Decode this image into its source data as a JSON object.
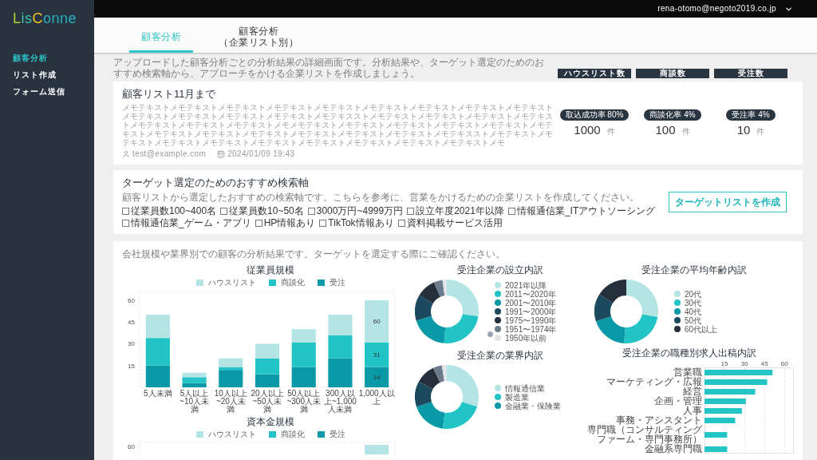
{
  "sidebar": {
    "logo": "LisConne",
    "items": [
      {
        "label": "顧客分析",
        "selected": true
      },
      {
        "label": "リスト作成",
        "selected": false
      },
      {
        "label": "フォーム送信",
        "selected": false
      }
    ]
  },
  "top_bar": {
    "user_email": "rena-otomo@negoto2019.co.jp"
  },
  "tabs": [
    {
      "label": "顧客分析",
      "selected": true
    },
    {
      "label": "顧客分析（企業リスト別）",
      "selected": false
    }
  ],
  "intro": "アップロードした顧客分析ごとの分析結果の詳細画面です。分析結果や、ターゲット選定のためのおすすめ検索軸から、アプローチをかける企業リストを作成しましょう。",
  "stat_headers": [
    "ハウスリスト数",
    "商談数",
    "受注数"
  ],
  "list_card": {
    "title": "顧客リスト11月まで",
    "memo": "メモテキストメモテキストメモテキストメモテキストメモテキストメモテキストメモテキストメモテキストメモテキストメモテキストメモテキストメモテキストメモテキストメモテキスストメモテキストメモテキストメモテキストメモテキストメモテキストメモテキストメモテキストメモメモテキストメモテキストメモテキストメモテキストメモテキストメモテキストメモテキストメモテキストメモテキストメモテキストメモテキストメモテキストメモテキスストメモテキストメモテキストメモテキストメモテキストメモテキストメモテキストメモテキストメモテキストメモテキストメモ",
    "owner": "test@example.com",
    "updated_at": "2024/01/09 19:43",
    "stats": [
      {
        "rate": "取込成功率 80%",
        "count": "1000",
        "unit": "件"
      },
      {
        "rate": "商談化率 4%",
        "count": "100",
        "unit": "件"
      },
      {
        "rate": "受注率 4%",
        "count": "10",
        "unit": "件"
      }
    ]
  },
  "target_card": {
    "title": "ターゲット選定のためのおすすめ検索軸",
    "description": "顧客リストから選定したおすすめの検索軸です。こちらを参考に、営業をかけるための企業リストを作成してください。",
    "criteria": [
      {
        "label": "従業員数100~400名",
        "checked": false
      },
      {
        "label": "従業員数10~50名",
        "checked": false
      },
      {
        "label": "3000万円~4999万円",
        "checked": false
      },
      {
        "label": "設立年度2021年以降",
        "checked": false
      },
      {
        "label": "情報通信業_ITアウトソーシング",
        "checked": false
      },
      {
        "label": "情報通信業_ゲーム・アプリ",
        "checked": false
      },
      {
        "label": "HP情報あり",
        "checked": false
      },
      {
        "label": "TikTok情報あり",
        "checked": false
      },
      {
        "label": "資料掲載サービス活用",
        "checked": false
      }
    ],
    "button": "ターゲットリストを作成"
  },
  "analysis": {
    "description": "会社規模や業界別での顧客の分析結果です。ターゲットを選定する際にご確認ください。",
    "employee_chart": {
      "chart_data": {
        "type": "bar",
        "title": "従業員規模",
        "categories": [
          "5人未満",
          "5人以上~10人未満",
          "10人以上~20人未満",
          "20人以上~50人未満",
          "50人以上~300人未満",
          "300人以上~1,000人未満",
          "1,000人以上"
        ],
        "series": [
          {
            "name": "受注",
            "color": "#0a99a6",
            "values": [
              15,
              3,
              12,
              9,
              14,
              20,
              14
            ]
          },
          {
            "name": "商談化",
            "color": "#22c4c6",
            "values": [
              19,
              4,
              2,
              11,
              17,
              16,
              17
            ]
          },
          {
            "name": "ハウスリスト",
            "color": "#b5e4e5",
            "values": [
              16,
              3,
              6,
              10,
              9,
              14,
              29
            ]
          }
        ],
        "legend": "top",
        "ylim": [
          0,
          66
        ],
        "yticks": [
          15,
          30,
          45,
          60
        ],
        "stacked": true,
        "annotations": [
          {
            "x": "1,000人以上",
            "y": 60,
            "text": "60"
          },
          {
            "x": "1,000人以上",
            "y": 31,
            "text": "31"
          },
          {
            "x": "1,000人以上",
            "y": 14,
            "text": "14"
          }
        ]
      }
    },
    "capital_chart": {
      "title": "資本金規模",
      "legend": [
        {
          "label": "ハウスリスト",
          "color": "#b5e4e5"
        },
        {
          "label": "商談化",
          "color": "#22c4c6"
        },
        {
          "label": "受注",
          "color": "#0a99a6"
        }
      ],
      "y_tick": "60"
    },
    "founding_chart": {
      "title": "受注企業の設立内訳",
      "legend": [
        {
          "label": "2021年以降",
          "color": "#b5e4e5"
        },
        {
          "label": "2011〜2020年",
          "color": "#22c4c6"
        },
        {
          "label": "2001〜2010年",
          "color": "#0a99a6"
        },
        {
          "label": "1991〜2000年",
          "color": "#1b4a5e"
        },
        {
          "label": "1975〜1990年",
          "color": "#262f3c"
        },
        {
          "label": "1951〜1974年",
          "color": "#6b7b8c"
        },
        {
          "label": "1950年以前",
          "color": "#e1e4e8"
        }
      ]
    },
    "industry_chart": {
      "title": "受注企業の業界内訳",
      "legend": [
        {
          "label": "情報通信業",
          "color": "#b5e4e5"
        },
        {
          "label": "製造業",
          "color": "#22c4c6"
        },
        {
          "label": "金融業・保険業",
          "color": "#0a99a6"
        }
      ]
    },
    "age_chart": {
      "title": "受注企業の平均年齢内訳",
      "legend": [
        {
          "label": "20代",
          "color": "#b5e4e5"
        },
        {
          "label": "30代",
          "color": "#22c4c6"
        },
        {
          "label": "40代",
          "color": "#0a99a6"
        },
        {
          "label": "50代",
          "color": "#1b4a5e"
        },
        {
          "label": "60代以上",
          "color": "#262f3c"
        }
      ]
    },
    "job_chart": {
      "chart_data": {
        "type": "bar",
        "orientation": "horizontal",
        "title": "受注企業の職種別求人出稿内訳",
        "categories": [
          "営業職",
          "マーケティング・広報",
          "経営",
          "企画・管理",
          "人事",
          "事務・アシスタント",
          "専門職（コンサルティングファーム・専門事務所）",
          "金融系専門職"
        ],
        "values": [
          51,
          47,
          38,
          31,
          28,
          23,
          17,
          17
        ],
        "xlim": [
          0,
          67
        ],
        "xticks": [
          15,
          30,
          45,
          60
        ],
        "grid": true
      }
    }
  }
}
